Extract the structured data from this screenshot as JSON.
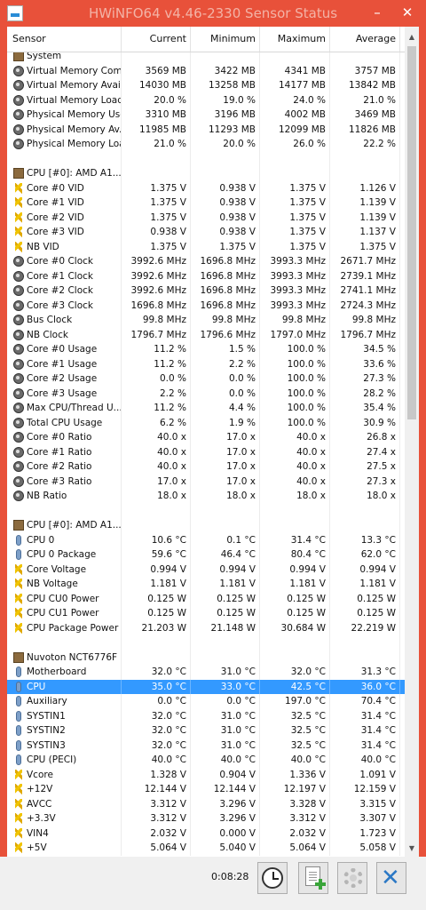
{
  "window": {
    "title": "HWiNFO64 v4.46-2330 Sensor Status",
    "minimize": "–",
    "close": "✕"
  },
  "columns": [
    "Sensor",
    "Current",
    "Minimum",
    "Maximum",
    "Average"
  ],
  "rows": [
    {
      "type": "group",
      "icon": "group-icon",
      "name": "System"
    },
    {
      "icon": "sensor-icon",
      "name": "Virtual Memory Com...",
      "cur": "3569 MB",
      "min": "3422 MB",
      "max": "4341 MB",
      "avg": "3757 MB"
    },
    {
      "icon": "sensor-icon",
      "name": "Virtual Memory Avai...",
      "cur": "14030 MB",
      "min": "13258 MB",
      "max": "14177 MB",
      "avg": "13842 MB"
    },
    {
      "icon": "sensor-icon",
      "name": "Virtual Memory Load",
      "cur": "20.0 %",
      "min": "19.0 %",
      "max": "24.0 %",
      "avg": "21.0 %"
    },
    {
      "icon": "sensor-icon",
      "name": "Physical Memory Used",
      "cur": "3310 MB",
      "min": "3196 MB",
      "max": "4002 MB",
      "avg": "3469 MB"
    },
    {
      "icon": "sensor-icon",
      "name": "Physical Memory Av...",
      "cur": "11985 MB",
      "min": "11293 MB",
      "max": "12099 MB",
      "avg": "11826 MB"
    },
    {
      "icon": "sensor-icon",
      "name": "Physical Memory Load",
      "cur": "21.0 %",
      "min": "20.0 %",
      "max": "26.0 %",
      "avg": "22.2 %"
    },
    {
      "type": "blank"
    },
    {
      "type": "group",
      "icon": "group-icon",
      "name": "CPU [#0]: AMD A1..."
    },
    {
      "icon": "volt-icon",
      "name": "Core #0 VID",
      "cur": "1.375 V",
      "min": "0.938 V",
      "max": "1.375 V",
      "avg": "1.126 V"
    },
    {
      "icon": "volt-icon",
      "name": "Core #1 VID",
      "cur": "1.375 V",
      "min": "0.938 V",
      "max": "1.375 V",
      "avg": "1.139 V"
    },
    {
      "icon": "volt-icon",
      "name": "Core #2 VID",
      "cur": "1.375 V",
      "min": "0.938 V",
      "max": "1.375 V",
      "avg": "1.139 V"
    },
    {
      "icon": "volt-icon",
      "name": "Core #3 VID",
      "cur": "0.938 V",
      "min": "0.938 V",
      "max": "1.375 V",
      "avg": "1.137 V"
    },
    {
      "icon": "volt-icon",
      "name": "NB VID",
      "cur": "1.375 V",
      "min": "1.375 V",
      "max": "1.375 V",
      "avg": "1.375 V"
    },
    {
      "icon": "sensor-icon",
      "name": "Core #0 Clock",
      "cur": "3992.6 MHz",
      "min": "1696.8 MHz",
      "max": "3993.3 MHz",
      "avg": "2671.7 MHz"
    },
    {
      "icon": "sensor-icon",
      "name": "Core #1 Clock",
      "cur": "3992.6 MHz",
      "min": "1696.8 MHz",
      "max": "3993.3 MHz",
      "avg": "2739.1 MHz"
    },
    {
      "icon": "sensor-icon",
      "name": "Core #2 Clock",
      "cur": "3992.6 MHz",
      "min": "1696.8 MHz",
      "max": "3993.3 MHz",
      "avg": "2741.1 MHz"
    },
    {
      "icon": "sensor-icon",
      "name": "Core #3 Clock",
      "cur": "1696.8 MHz",
      "min": "1696.8 MHz",
      "max": "3993.3 MHz",
      "avg": "2724.3 MHz"
    },
    {
      "icon": "sensor-icon",
      "name": "Bus Clock",
      "cur": "99.8 MHz",
      "min": "99.8 MHz",
      "max": "99.8 MHz",
      "avg": "99.8 MHz"
    },
    {
      "icon": "sensor-icon",
      "name": "NB Clock",
      "cur": "1796.7 MHz",
      "min": "1796.6 MHz",
      "max": "1797.0 MHz",
      "avg": "1796.7 MHz"
    },
    {
      "icon": "sensor-icon",
      "name": "Core #0 Usage",
      "cur": "11.2 %",
      "min": "1.5 %",
      "max": "100.0 %",
      "avg": "34.5 %"
    },
    {
      "icon": "sensor-icon",
      "name": "Core #1 Usage",
      "cur": "11.2 %",
      "min": "2.2 %",
      "max": "100.0 %",
      "avg": "33.6 %"
    },
    {
      "icon": "sensor-icon",
      "name": "Core #2 Usage",
      "cur": "0.0 %",
      "min": "0.0 %",
      "max": "100.0 %",
      "avg": "27.3 %"
    },
    {
      "icon": "sensor-icon",
      "name": "Core #3 Usage",
      "cur": "2.2 %",
      "min": "0.0 %",
      "max": "100.0 %",
      "avg": "28.2 %"
    },
    {
      "icon": "sensor-icon",
      "name": "Max CPU/Thread U...",
      "cur": "11.2 %",
      "min": "4.4 %",
      "max": "100.0 %",
      "avg": "35.4 %"
    },
    {
      "icon": "sensor-icon",
      "name": "Total CPU Usage",
      "cur": "6.2 %",
      "min": "1.9 %",
      "max": "100.0 %",
      "avg": "30.9 %"
    },
    {
      "icon": "sensor-icon",
      "name": "Core #0 Ratio",
      "cur": "40.0 x",
      "min": "17.0 x",
      "max": "40.0 x",
      "avg": "26.8 x"
    },
    {
      "icon": "sensor-icon",
      "name": "Core #1 Ratio",
      "cur": "40.0 x",
      "min": "17.0 x",
      "max": "40.0 x",
      "avg": "27.4 x"
    },
    {
      "icon": "sensor-icon",
      "name": "Core #2 Ratio",
      "cur": "40.0 x",
      "min": "17.0 x",
      "max": "40.0 x",
      "avg": "27.5 x"
    },
    {
      "icon": "sensor-icon",
      "name": "Core #3 Ratio",
      "cur": "17.0 x",
      "min": "17.0 x",
      "max": "40.0 x",
      "avg": "27.3 x"
    },
    {
      "icon": "sensor-icon",
      "name": "NB Ratio",
      "cur": "18.0 x",
      "min": "18.0 x",
      "max": "18.0 x",
      "avg": "18.0 x"
    },
    {
      "type": "blank"
    },
    {
      "type": "group",
      "icon": "group-icon",
      "name": "CPU [#0]: AMD A1..."
    },
    {
      "icon": "temp-icon",
      "name": "CPU 0",
      "cur": "10.6 °C",
      "min": "0.1 °C",
      "max": "31.4 °C",
      "avg": "13.3 °C"
    },
    {
      "icon": "temp-icon",
      "name": "CPU 0 Package",
      "cur": "59.6 °C",
      "min": "46.4 °C",
      "max": "80.4 °C",
      "avg": "62.0 °C"
    },
    {
      "icon": "volt-icon",
      "name": "Core Voltage",
      "cur": "0.994 V",
      "min": "0.994 V",
      "max": "0.994 V",
      "avg": "0.994 V"
    },
    {
      "icon": "volt-icon",
      "name": "NB Voltage",
      "cur": "1.181 V",
      "min": "1.181 V",
      "max": "1.181 V",
      "avg": "1.181 V"
    },
    {
      "icon": "volt-icon",
      "name": "CPU CU0 Power",
      "cur": "0.125 W",
      "min": "0.125 W",
      "max": "0.125 W",
      "avg": "0.125 W"
    },
    {
      "icon": "volt-icon",
      "name": "CPU CU1 Power",
      "cur": "0.125 W",
      "min": "0.125 W",
      "max": "0.125 W",
      "avg": "0.125 W"
    },
    {
      "icon": "volt-icon",
      "name": "CPU Package Power",
      "cur": "21.203 W",
      "min": "21.148 W",
      "max": "30.684 W",
      "avg": "22.219 W"
    },
    {
      "type": "blank"
    },
    {
      "type": "group",
      "icon": "group-icon",
      "name": "Nuvoton NCT6776F"
    },
    {
      "icon": "temp-icon",
      "name": "Motherboard",
      "cur": "32.0 °C",
      "min": "31.0 °C",
      "max": "32.0 °C",
      "avg": "31.3 °C"
    },
    {
      "icon": "temp-icon",
      "name": "CPU",
      "cur": "35.0 °C",
      "min": "33.0 °C",
      "max": "42.5 °C",
      "avg": "36.0 °C",
      "selected": true
    },
    {
      "icon": "temp-icon",
      "name": "Auxiliary",
      "cur": "0.0 °C",
      "min": "0.0 °C",
      "max": "197.0 °C",
      "avg": "70.4 °C"
    },
    {
      "icon": "temp-icon",
      "name": "SYSTIN1",
      "cur": "32.0 °C",
      "min": "31.0 °C",
      "max": "32.5 °C",
      "avg": "31.4 °C"
    },
    {
      "icon": "temp-icon",
      "name": "SYSTIN2",
      "cur": "32.0 °C",
      "min": "31.0 °C",
      "max": "32.5 °C",
      "avg": "31.4 °C"
    },
    {
      "icon": "temp-icon",
      "name": "SYSTIN3",
      "cur": "32.0 °C",
      "min": "31.0 °C",
      "max": "32.5 °C",
      "avg": "31.4 °C"
    },
    {
      "icon": "temp-icon",
      "name": "CPU (PECI)",
      "cur": "40.0 °C",
      "min": "40.0 °C",
      "max": "40.0 °C",
      "avg": "40.0 °C"
    },
    {
      "icon": "volt-icon",
      "name": "Vcore",
      "cur": "1.328 V",
      "min": "0.904 V",
      "max": "1.336 V",
      "avg": "1.091 V"
    },
    {
      "icon": "volt-icon",
      "name": "+12V",
      "cur": "12.144 V",
      "min": "12.144 V",
      "max": "12.197 V",
      "avg": "12.159 V"
    },
    {
      "icon": "volt-icon",
      "name": "AVCC",
      "cur": "3.312 V",
      "min": "3.296 V",
      "max": "3.328 V",
      "avg": "3.315 V"
    },
    {
      "icon": "volt-icon",
      "name": "+3.3V",
      "cur": "3.312 V",
      "min": "3.296 V",
      "max": "3.312 V",
      "avg": "3.307 V"
    },
    {
      "icon": "volt-icon",
      "name": "VIN4",
      "cur": "2.032 V",
      "min": "0.000 V",
      "max": "2.032 V",
      "avg": "1.723 V"
    },
    {
      "icon": "volt-icon",
      "name": "+5V",
      "cur": "5.064 V",
      "min": "5.040 V",
      "max": "5.064 V",
      "avg": "5.058 V"
    }
  ],
  "footer": {
    "elapsed": "0:08:28"
  },
  "colors": {
    "titlebar": "#e8513a",
    "selection": "#3399ff",
    "close_button": "#2b78c5"
  }
}
